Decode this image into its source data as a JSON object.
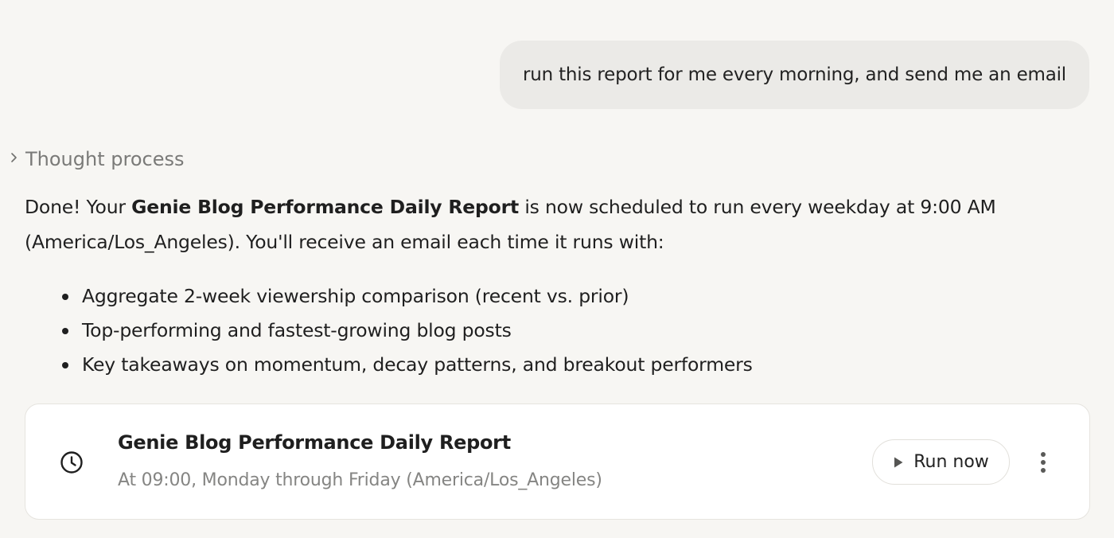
{
  "user_message": "run this report for me every morning, and send me an email",
  "thought_toggle_label": "Thought process",
  "reply": {
    "prefix": "Done! Your ",
    "report_name": "Genie Blog Performance Daily Report",
    "suffix": " is now scheduled to run every weekday at 9:00 AM (America/Los_Angeles). You'll receive an email each time it runs with:",
    "bullets": [
      "Aggregate 2-week viewership comparison (recent vs. prior)",
      "Top-performing and fastest-growing blog posts",
      "Key takeaways on momentum, decay patterns, and breakout performers"
    ]
  },
  "schedule_card": {
    "title": "Genie Blog Performance Daily Report",
    "schedule": "At 09:00, Monday through Friday (America/Los_Angeles)",
    "run_button_label": "Run now",
    "icons": {
      "schedule": "clock-icon",
      "run": "play-icon",
      "menu": "more-vertical-icon"
    }
  },
  "colors": {
    "background": "#f7f6f3",
    "user_bubble": "#ebeae7",
    "card": "#ffffff",
    "muted_text": "#858583"
  }
}
